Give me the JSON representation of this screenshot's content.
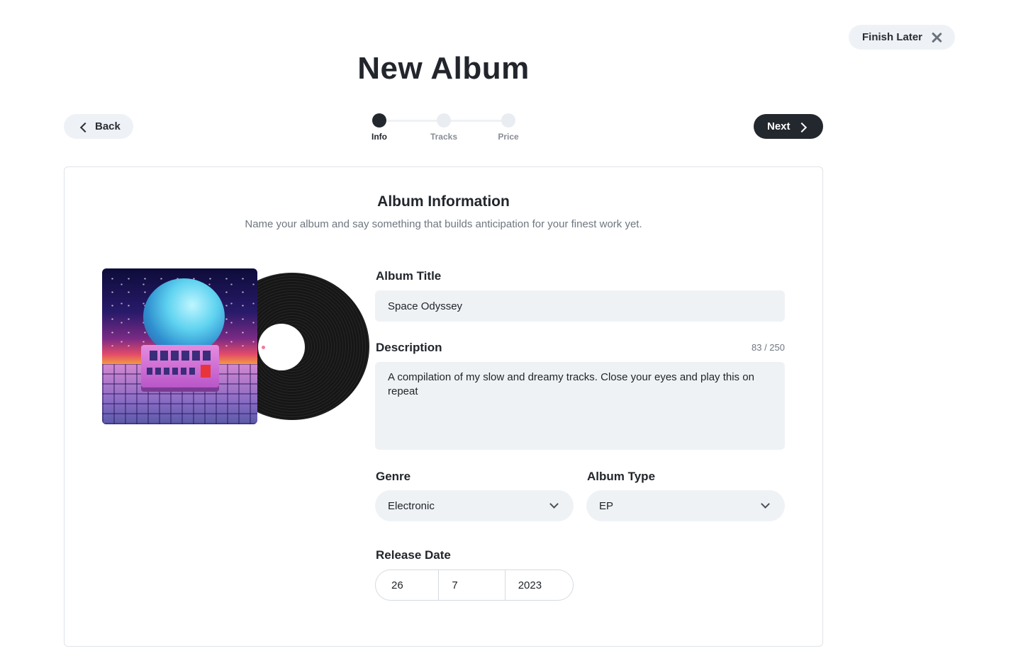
{
  "header": {
    "title": "New Album",
    "finish_later_label": "Finish Later",
    "back_label": "Back",
    "next_label": "Next"
  },
  "stepper": {
    "steps": [
      {
        "label": "Info",
        "active": true
      },
      {
        "label": "Tracks",
        "active": false
      },
      {
        "label": "Price",
        "active": false
      }
    ]
  },
  "card": {
    "title": "Album Information",
    "subtitle": "Name your album and say something that builds anticipation for your finest work yet."
  },
  "form": {
    "album_title": {
      "label": "Album Title",
      "value": "Space Odyssey"
    },
    "description": {
      "label": "Description",
      "value": "A compilation of my slow and dreamy tracks. Close your eyes and play this on repeat",
      "counter": "83 / 250"
    },
    "genre": {
      "label": "Genre",
      "value": "Electronic"
    },
    "album_type": {
      "label": "Album Type",
      "value": "EP"
    },
    "release_date": {
      "label": "Release Date",
      "day": "26",
      "month": "7",
      "year": "2023"
    }
  },
  "colors": {
    "primary_dark": "#23272e",
    "input_bg": "#eff2f5",
    "muted_text": "#6f7680"
  }
}
